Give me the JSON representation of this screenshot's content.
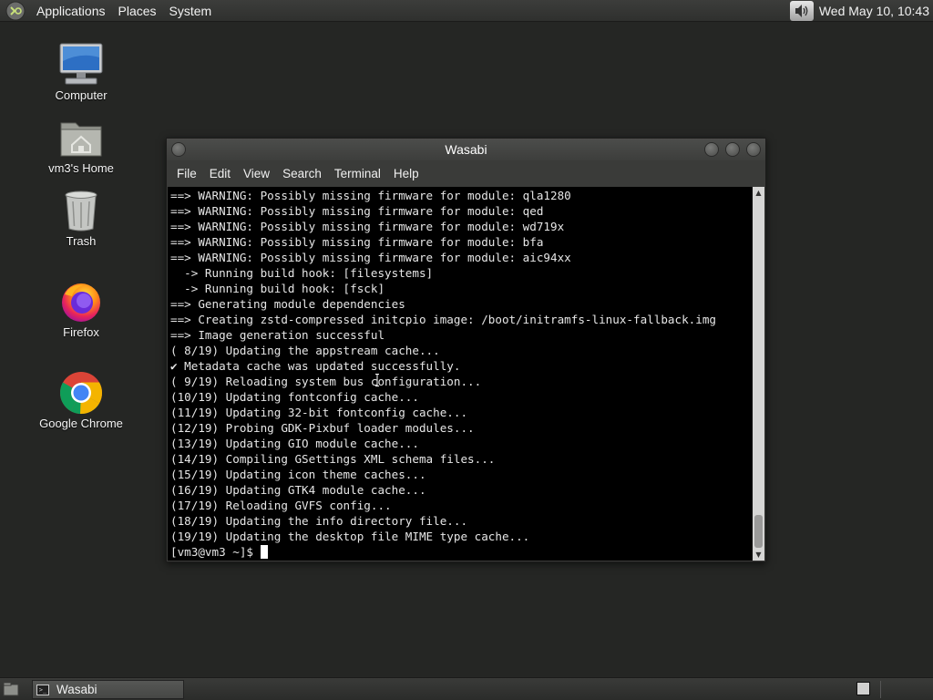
{
  "top_panel": {
    "menus": [
      "Applications",
      "Places",
      "System"
    ],
    "clock": "Wed May 10, 10:43",
    "icons": {
      "logo": "distro-logo-icon",
      "volume": "volume-icon"
    }
  },
  "desktop": {
    "icons": [
      {
        "label": "Computer",
        "icon": "computer-icon"
      },
      {
        "label": "vm3's Home",
        "icon": "home-folder-icon"
      },
      {
        "label": "Trash",
        "icon": "trash-icon"
      },
      {
        "label": "Firefox",
        "icon": "firefox-icon"
      },
      {
        "label": "Google Chrome",
        "icon": "chrome-icon"
      }
    ]
  },
  "window": {
    "title": "Wasabi",
    "menu": [
      "File",
      "Edit",
      "View",
      "Search",
      "Terminal",
      "Help"
    ],
    "terminal_lines": [
      "==> WARNING: Possibly missing firmware for module: qla1280",
      "==> WARNING: Possibly missing firmware for module: qed",
      "==> WARNING: Possibly missing firmware for module: wd719x",
      "==> WARNING: Possibly missing firmware for module: bfa",
      "==> WARNING: Possibly missing firmware for module: aic94xx",
      "  -> Running build hook: [filesystems]",
      "  -> Running build hook: [fsck]",
      "==> Generating module dependencies",
      "==> Creating zstd-compressed initcpio image: /boot/initramfs-linux-fallback.img",
      "==> Image generation successful",
      "( 8/19) Updating the appstream cache...",
      "✔ Metadata cache was updated successfully.",
      "( 9/19) Reloading system bus configuration...",
      "(10/19) Updating fontconfig cache...",
      "(11/19) Updating 32-bit fontconfig cache...",
      "(12/19) Probing GDK-Pixbuf loader modules...",
      "(13/19) Updating GIO module cache...",
      "(14/19) Compiling GSettings XML schema files...",
      "(15/19) Updating icon theme caches...",
      "(16/19) Updating GTK4 module cache...",
      "(17/19) Reloading GVFS config...",
      "(18/19) Updating the info directory file...",
      "(19/19) Updating the desktop file MIME type cache..."
    ],
    "prompt": "[vm3@vm3 ~]$ "
  },
  "taskbar": {
    "tasks": [
      {
        "label": "Wasabi",
        "icon": "terminal-icon"
      }
    ]
  }
}
